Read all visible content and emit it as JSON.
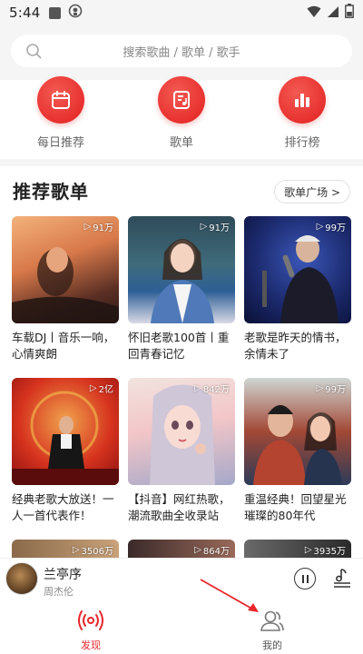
{
  "status_bar": {
    "time": "5:44"
  },
  "search": {
    "placeholder": "搜索歌曲 / 歌单 / 歌手"
  },
  "quick_entries": [
    {
      "label": "每日推荐",
      "icon": "calendar-icon"
    },
    {
      "label": "歌单",
      "icon": "playlist-icon"
    },
    {
      "label": "排行榜",
      "icon": "chart-bars-icon"
    }
  ],
  "recommend": {
    "title": "推荐歌单",
    "plaza_label": "歌单广场 >"
  },
  "playlists": [
    {
      "count": "91万",
      "title": "车载DJ丨音乐一响，心情爽朗"
    },
    {
      "count": "91万",
      "title": "怀旧老歌100首丨重回青春记忆"
    },
    {
      "count": "99万",
      "title": "老歌是昨天的情书，余情未了"
    },
    {
      "count": "2亿",
      "title": "经典老歌大放送！一人一首代表作！"
    },
    {
      "count": "842万",
      "title": "【抖音】网红热歌，潮流歌曲全收录站"
    },
    {
      "count": "99万",
      "title": "重温经典！回望星光璀璨的80年代"
    },
    {
      "count": "3506万",
      "title": ""
    },
    {
      "count": "864万",
      "title": ""
    },
    {
      "count": "3935万",
      "title": ""
    }
  ],
  "mini_player": {
    "song": "兰亭序",
    "artist": "周杰伦"
  },
  "bottom_nav": [
    {
      "label": "发现",
      "active": true,
      "icon": "radio-wave-icon"
    },
    {
      "label": "我的",
      "active": false,
      "icon": "user-icon"
    }
  ],
  "colors": {
    "accent": "#e8262b",
    "background": "#f5f5f5"
  }
}
